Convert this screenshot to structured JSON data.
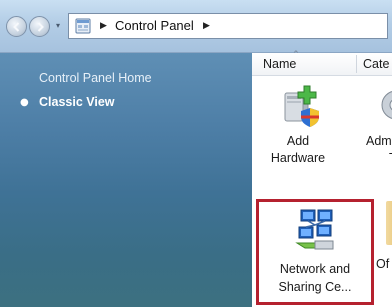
{
  "address_bar": {
    "breadcrumb": "Control Panel",
    "icons": [
      "back-arrow-icon",
      "forward-arrow-icon",
      "control-panel-icon"
    ]
  },
  "task_pane": {
    "home_link": "Control Panel Home",
    "classic_view": "Classic View"
  },
  "columns": {
    "name": "Name",
    "category": "Cate"
  },
  "items": {
    "add_hardware": {
      "line1": "Add",
      "line2": "Hardware",
      "icon": "add-hardware-icon"
    },
    "admin_tools": {
      "line1": "Adm",
      "line2": "T",
      "icon": "administrative-tools-icon"
    },
    "network_sharing": {
      "line1": "Network and",
      "line2": "Sharing Ce...",
      "icon": "network-sharing-icon"
    },
    "offline_files": {
      "line1": "Of",
      "icon": "offline-files-icon"
    }
  },
  "colors": {
    "highlight_border": "#b5212f",
    "pane_top": "#5f8fb5",
    "pane_bottom": "#3c7080"
  }
}
